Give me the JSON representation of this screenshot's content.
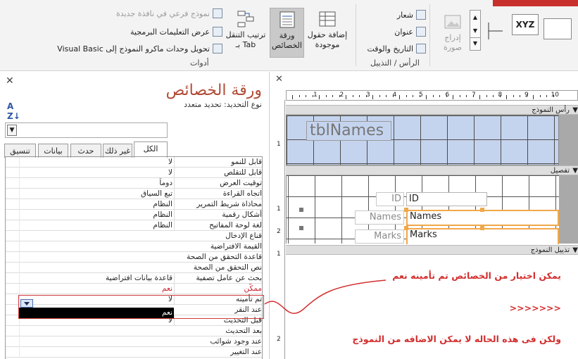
{
  "ribbon": {
    "tools_group": {
      "label": "أدوات",
      "subform_new_window": "نموذج فرعي في نافذة جديدة",
      "view_code": "عرض التعليمات البرمجية",
      "convert_macros": "تحويل وحدات ماكرو النموذج إلى Visual Basic",
      "add_existing_fields": "إضافة حقول موجودة",
      "property_sheet": "ورقة الخصائص",
      "tab_order": "ترتيب التنقل بـ Tab"
    },
    "header_footer_group": {
      "label": "الرأس / التذييل",
      "logo": "شعار",
      "title": "عنوان",
      "date_time": "التاريخ والوقت"
    },
    "controls_group": {
      "insert_image": "إدراج صورة",
      "xyz": "XYZ"
    }
  },
  "property_sheet": {
    "title": "ورقة الخصائص",
    "selection_type_label": "نوع التحديد:",
    "selection_type_value": "تحديد متعدد",
    "tabs": [
      "الكل",
      "غير ذلك",
      "حدث",
      "بيانات",
      "تنسيق"
    ],
    "active_tab": "الكل",
    "rows": [
      {
        "label": "قابل للنمو",
        "value": "لا"
      },
      {
        "label": "قابل للتقلص",
        "value": "لا"
      },
      {
        "label": "توقيت العرض",
        "value": "دوماً"
      },
      {
        "label": "اتجاه القراءة",
        "value": "تبع السياق"
      },
      {
        "label": "محاذاة شريط التمرير",
        "value": "النظام"
      },
      {
        "label": "أشكال رقمية",
        "value": "النظام"
      },
      {
        "label": "لغة لوحة المفاتيح",
        "value": "النظام"
      },
      {
        "label": "قناع الإدخال",
        "value": ""
      },
      {
        "label": "القيمة الافتراضية",
        "value": ""
      },
      {
        "label": "قاعدة التحقق من الصحة",
        "value": ""
      },
      {
        "label": "نص التحقق من الصحة",
        "value": ""
      },
      {
        "label": "بحث عن عامل تصفية",
        "value": "قاعدة بيانات افتراضية"
      },
      {
        "label": "ممكَّن",
        "value": "نعم"
      },
      {
        "label": "تم تأمينه",
        "value": "لا"
      },
      {
        "label": "عند النقر",
        "value": ""
      },
      {
        "label": "قبل التحديث",
        "value": "لا"
      },
      {
        "label": "بعد التحديث",
        "value": ""
      },
      {
        "label": "عند وجود شوائب",
        "value": ""
      },
      {
        "label": "عند التغيير",
        "value": ""
      }
    ],
    "dropdown_option": "نعم"
  },
  "designer": {
    "ruler_numbers": [
      "1",
      "2",
      "3",
      "4",
      "5",
      "6",
      "7",
      "8",
      "9",
      "10"
    ],
    "vruler_numbers": [
      "1",
      "1",
      "2",
      "1",
      "2"
    ],
    "band_header": "رأس النموذج",
    "band_detail": "تفصيل",
    "band_footer": "تذييل النموذج",
    "header_label": "tblNames",
    "fields": [
      {
        "label": "ID",
        "box": "ID"
      },
      {
        "label": "Names",
        "box": "Names"
      },
      {
        "label": "Marks",
        "box": "Marks"
      }
    ]
  },
  "annotations": {
    "line1": "يمكن اختيار من الخصائص تم تأمينه نعم",
    "line2": "<<<<<<<",
    "line3": "ولكن فى هذه الحاله لا يمكن الاضافه من النموذج"
  },
  "colors": {
    "accent_red": "#d32f2f",
    "title_brown": "#b14b36",
    "header_blue": "#c5d4ee",
    "selection_orange": "#f0a84a"
  }
}
